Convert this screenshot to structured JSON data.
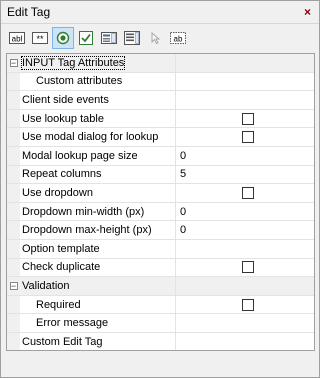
{
  "window": {
    "title": "Edit Tag",
    "close_glyph": "×"
  },
  "toolbar": [
    {
      "name": "text-box-icon",
      "glyph": "abl"
    },
    {
      "name": "password-icon",
      "glyph": "**"
    },
    {
      "name": "radio-button-icon",
      "glyph": "radio",
      "active": true
    },
    {
      "name": "checkbox-icon",
      "glyph": "check"
    },
    {
      "name": "select-icon",
      "glyph": "select"
    },
    {
      "name": "list-icon",
      "glyph": "list"
    },
    {
      "name": "hyperlink-icon",
      "glyph": "link",
      "disabled": true
    },
    {
      "name": "label-icon",
      "glyph": "ab"
    }
  ],
  "grid": {
    "rows": [
      {
        "type": "category",
        "label": "INPUT Tag Attributes",
        "expander": "−"
      },
      {
        "type": "prop",
        "label": "Custom attributes",
        "indent": true,
        "value": ""
      },
      {
        "type": "prop",
        "label": "Client side events",
        "value": ""
      },
      {
        "type": "prop",
        "label": "Use lookup table",
        "checkbox": true
      },
      {
        "type": "prop",
        "label": "Use modal dialog for lookup",
        "checkbox": true
      },
      {
        "type": "prop",
        "label": "Modal lookup page size",
        "value": "0"
      },
      {
        "type": "prop",
        "label": "Repeat columns",
        "value": "5"
      },
      {
        "type": "prop",
        "label": "Use dropdown",
        "checkbox": true
      },
      {
        "type": "prop",
        "label": "Dropdown min-width (px)",
        "value": "0"
      },
      {
        "type": "prop",
        "label": "Dropdown max-height (px)",
        "value": "0"
      },
      {
        "type": "prop",
        "label": "Option template",
        "value": ""
      },
      {
        "type": "prop",
        "label": "Check duplicate",
        "checkbox": true
      },
      {
        "type": "category",
        "label": "Validation",
        "expander": "−"
      },
      {
        "type": "prop",
        "label": "Required",
        "indent": true,
        "checkbox": true
      },
      {
        "type": "prop",
        "label": "Error message",
        "indent": true,
        "value": ""
      },
      {
        "type": "prop",
        "label": "Custom Edit Tag",
        "value": ""
      }
    ]
  }
}
